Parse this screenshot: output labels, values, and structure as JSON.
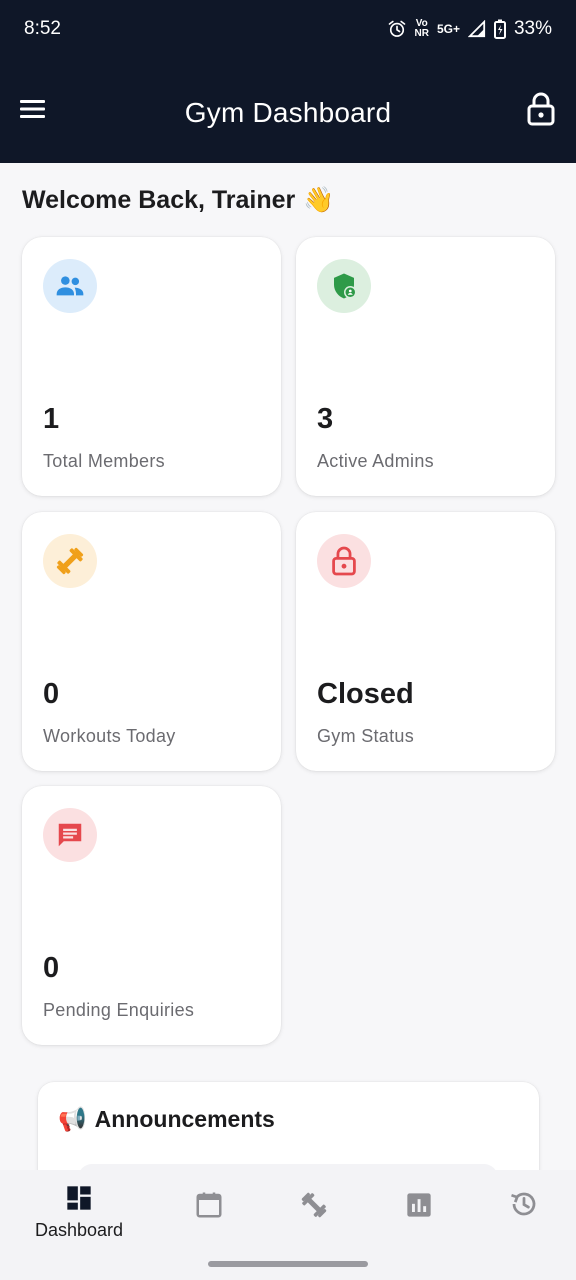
{
  "status": {
    "time": "8:52",
    "net_top": "Vo",
    "net_bottom": "NR",
    "network": "5G+",
    "battery": "33%"
  },
  "appbar": {
    "title": "Gym Dashboard"
  },
  "welcome": {
    "text": "Welcome Back, Trainer",
    "emoji": "👋"
  },
  "cards": [
    {
      "value": "1",
      "label": "Total Members",
      "icon": "people-icon",
      "color": "#2f8fe0",
      "bg": "#dcecfb"
    },
    {
      "value": "3",
      "label": "Active Admins",
      "icon": "admin-shield-icon",
      "color": "#2e9a48",
      "bg": "#dcefdf"
    },
    {
      "value": "0",
      "label": "Workouts Today",
      "icon": "dumbbell-icon",
      "color": "#f0a01a",
      "bg": "#fdefd8"
    },
    {
      "value": "Closed",
      "label": "Gym Status",
      "icon": "lock-icon",
      "color": "#e5484d",
      "bg": "#fbe0e1"
    },
    {
      "value": "0",
      "label": "Pending Enquiries",
      "icon": "message-icon",
      "color": "#e5484d",
      "bg": "#fbe0e1"
    }
  ],
  "announcements": {
    "emoji": "📢",
    "title": "Announcements"
  },
  "nav": {
    "items": [
      {
        "label": "Dashboard",
        "icon": "dashboard-icon",
        "active": true
      },
      {
        "label": "",
        "icon": "calendar-icon",
        "active": false
      },
      {
        "label": "",
        "icon": "dumbbell-icon",
        "active": false
      },
      {
        "label": "",
        "icon": "chart-icon",
        "active": false
      },
      {
        "label": "",
        "icon": "history-icon",
        "active": false
      }
    ]
  },
  "colors": {
    "appbar": "#0f1728",
    "accent_nav": "#0f1728",
    "inactive_nav": "#8e8e93"
  }
}
